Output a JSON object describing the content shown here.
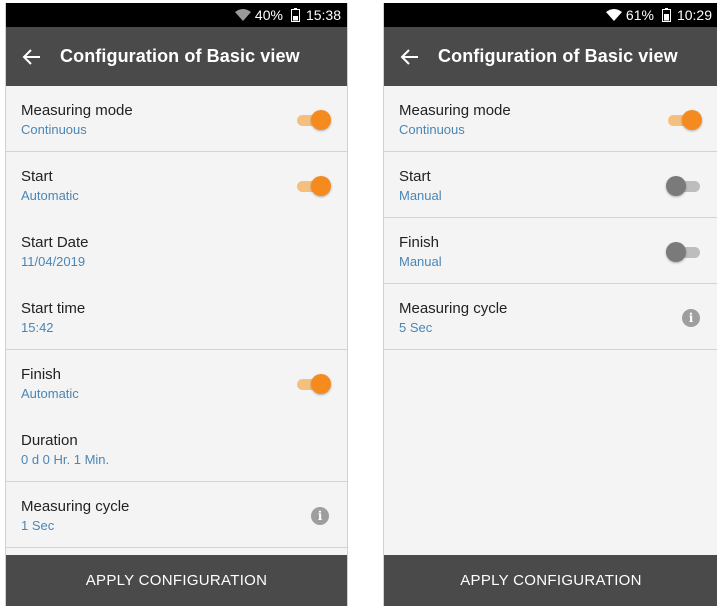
{
  "left": {
    "status": {
      "battery": "40%",
      "time": "15:38"
    },
    "title": "Configuration of Basic view",
    "items": [
      {
        "label": "Measuring mode",
        "value": "Continuous"
      },
      {
        "label": "Start",
        "value": "Automatic"
      },
      {
        "label": "Start Date",
        "value": "11/04/2019"
      },
      {
        "label": "Start time",
        "value": "15:42"
      },
      {
        "label": "Finish",
        "value": "Automatic"
      },
      {
        "label": "Duration",
        "value": "0 d 0 Hr. 1 Min."
      },
      {
        "label": "Measuring cycle",
        "value": "1 Sec"
      }
    ],
    "toggles": {
      "measuring_mode": true,
      "start": true,
      "finish": true
    },
    "apply_label": "APPLY CONFIGURATION"
  },
  "right": {
    "status": {
      "battery": "61%",
      "time": "10:29"
    },
    "title": "Configuration of Basic view",
    "items": [
      {
        "label": "Measuring mode",
        "value": "Continuous"
      },
      {
        "label": "Start",
        "value": "Manual"
      },
      {
        "label": "Finish",
        "value": "Manual"
      },
      {
        "label": "Measuring cycle",
        "value": "5 Sec"
      }
    ],
    "toggles": {
      "measuring_mode": true,
      "start": false,
      "finish": false
    },
    "apply_label": "APPLY CONFIGURATION"
  },
  "colors": {
    "accent": "#f58b1f",
    "app_bar": "#4a4a4a",
    "value_text": "#4a86b6"
  },
  "icons": {
    "back": "arrow-left-icon",
    "wifi": "wifi-icon",
    "battery": "battery-icon",
    "info": "info-icon"
  }
}
